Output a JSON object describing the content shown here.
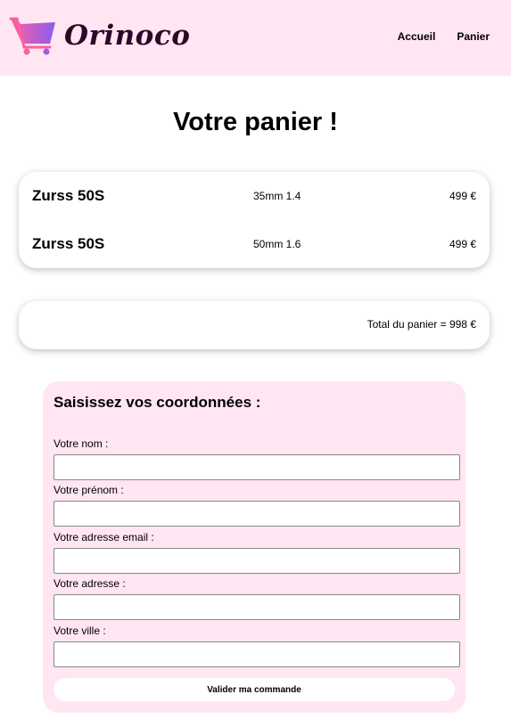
{
  "brand": {
    "name": "Orinoco"
  },
  "nav": {
    "home": "Accueil",
    "cart": "Panier"
  },
  "page": {
    "title": "Votre panier !"
  },
  "cart": {
    "items": [
      {
        "name": "Zurss 50S",
        "option": "35mm 1.4",
        "price": "499 €"
      },
      {
        "name": "Zurss 50S",
        "option": "50mm 1.6",
        "price": "499 €"
      }
    ],
    "total": "Total du panier = 998 €"
  },
  "form": {
    "title": "Saisissez vos coordonnées :",
    "fields": [
      {
        "label": "Votre nom :",
        "value": ""
      },
      {
        "label": "Votre prénom :",
        "value": ""
      },
      {
        "label": "Votre adresse email :",
        "value": ""
      },
      {
        "label": "Votre adresse :",
        "value": ""
      },
      {
        "label": "Votre ville :",
        "value": ""
      }
    ],
    "submit": "Valider ma commande"
  },
  "colors": {
    "header_bg": "#ffe6f2",
    "form_bg": "#ffe6f2",
    "logo_gradient_start": "#ff5fa0",
    "logo_gradient_end": "#8a5bf0"
  }
}
